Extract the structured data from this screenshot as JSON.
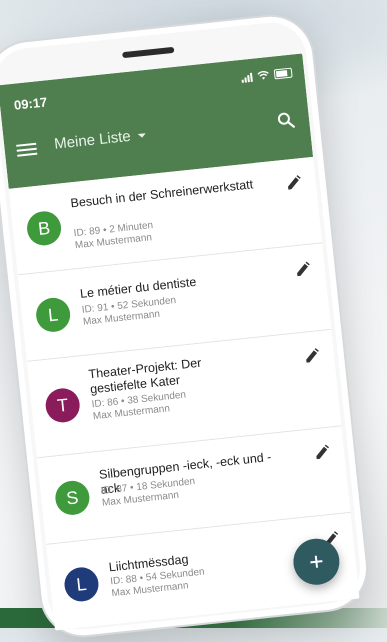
{
  "status_bar": {
    "time": "09:17"
  },
  "app_bar": {
    "list_title": "Meine Liste"
  },
  "colors": {
    "app_bar": "#4f7f4f",
    "avatar_green": "#3f9a3c",
    "avatar_purple": "#8a1c5c",
    "avatar_navy": "#1f3b7a",
    "fab": "#2f5a5f"
  },
  "items": [
    {
      "initial": "B",
      "title": "Besuch in der Schreinerwerkstatt",
      "meta": "ID: 89  •  2 Minuten",
      "author": "Max Mustermann",
      "avatar_color": "#3f9a3c"
    },
    {
      "initial": "L",
      "title": "Le métier du dentiste",
      "meta": "ID: 91  •  52 Sekunden",
      "author": "Max Mustermann",
      "avatar_color": "#3f9a3c"
    },
    {
      "initial": "T",
      "title": "Theater-Projekt: Der gestiefelte Kater",
      "meta": "ID: 86  •  38 Sekunden",
      "author": "Max Mustermann",
      "avatar_color": "#8a1c5c"
    },
    {
      "initial": "S",
      "title": "Silbengruppen -ieck, -eck und -ack",
      "meta": "ID: 87  •  18 Sekunden",
      "author": "Max Mustermann",
      "avatar_color": "#3f9a3c"
    },
    {
      "initial": "L",
      "title": "Liichtmëssdag",
      "meta": "ID: 88  •  54 Sekunden",
      "author": "Max Mustermann",
      "avatar_color": "#1f3b7a"
    }
  ],
  "icons": {
    "menu": "menu-icon",
    "search": "search-icon",
    "edit": "pencil-icon",
    "add": "plus-icon"
  }
}
